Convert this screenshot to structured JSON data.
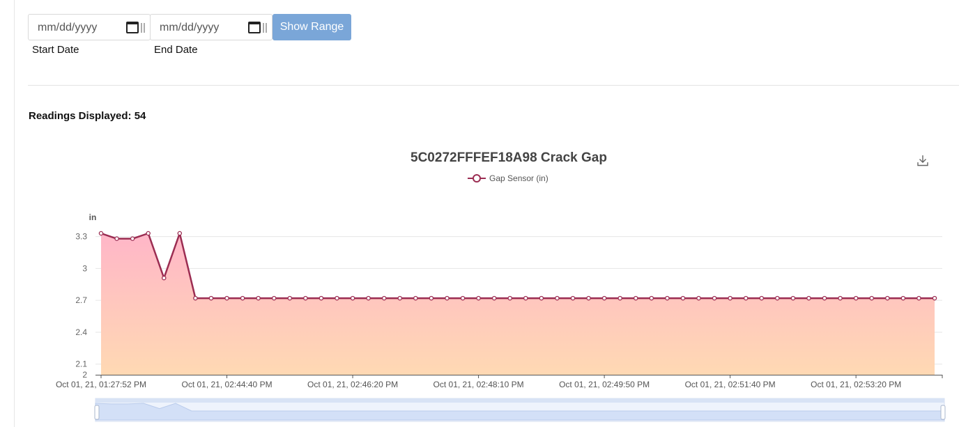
{
  "filters": {
    "start_date": {
      "placeholder": "mm/dd/yyyy",
      "label": "Start Date"
    },
    "end_date": {
      "placeholder": "mm/dd/yyyy",
      "label": "End Date"
    },
    "show_range_label": "Show Range"
  },
  "readings": {
    "text": "Readings Displayed: 54"
  },
  "colors": {
    "line": "#9b2d52",
    "area_top": "#ffb6c8",
    "area_bottom": "#ffd9b3",
    "button": "#7aa6d8"
  },
  "icons": {
    "download": "download-icon",
    "calendar": "calendar-icon"
  },
  "chart_data": {
    "type": "area",
    "title": "5C0272FFFEF18A98 Crack Gap",
    "ylabel": "in",
    "xlabel": "",
    "ylim": [
      2,
      3.33
    ],
    "yticks": [
      2,
      2.1,
      2.4,
      2.7,
      3,
      3.3
    ],
    "ytick_labels": [
      "2",
      "2.1",
      "2.4",
      "2.7",
      "3",
      "3.3"
    ],
    "xtick_labels": [
      "Oct 01, 21, 01:27:52 PM",
      "Oct 01, 21, 02:44:40 PM",
      "Oct 01, 21, 02:46:20 PM",
      "Oct 01, 21, 02:48:10 PM",
      "Oct 01, 21, 02:49:50 PM",
      "Oct 01, 21, 02:51:40 PM",
      "Oct 01, 21, 02:53:20 PM"
    ],
    "xtick_indices": [
      0,
      8,
      16,
      24,
      32,
      40,
      48
    ],
    "grid": true,
    "legend_position": "top-center",
    "series": [
      {
        "name": "Gap Sensor (in)",
        "values": [
          3.33,
          3.28,
          3.28,
          3.33,
          2.91,
          3.33,
          2.72,
          2.72,
          2.72,
          2.72,
          2.72,
          2.72,
          2.72,
          2.72,
          2.72,
          2.72,
          2.72,
          2.72,
          2.72,
          2.72,
          2.72,
          2.72,
          2.72,
          2.72,
          2.72,
          2.72,
          2.72,
          2.72,
          2.72,
          2.72,
          2.72,
          2.72,
          2.72,
          2.72,
          2.72,
          2.72,
          2.72,
          2.72,
          2.72,
          2.72,
          2.72,
          2.72,
          2.72,
          2.72,
          2.72,
          2.72,
          2.72,
          2.72,
          2.72,
          2.72,
          2.72,
          2.72,
          2.72,
          2.72
        ]
      }
    ]
  }
}
